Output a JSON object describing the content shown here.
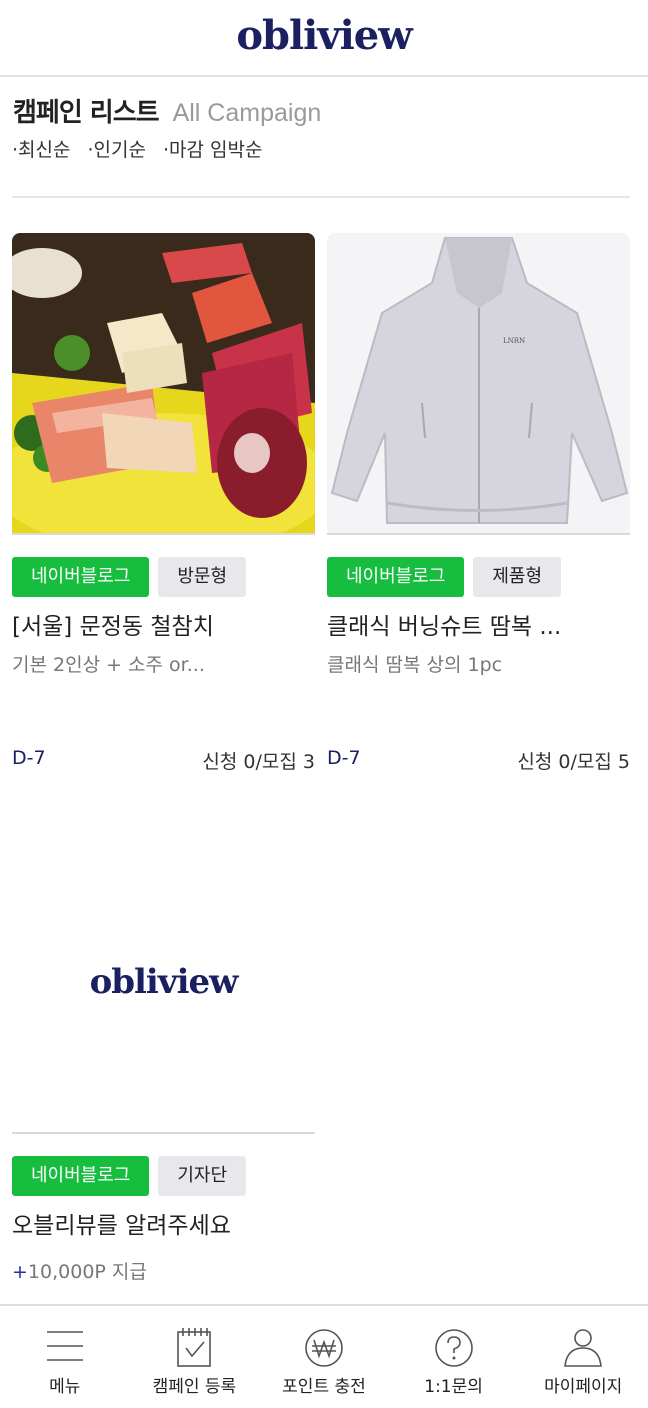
{
  "header": {
    "logo": "obliview"
  },
  "section": {
    "title": "캠페인 리스트",
    "subtitle": "All Campaign",
    "sort_options": [
      "·최신순",
      "·인기순",
      "·마감 임박순"
    ]
  },
  "campaigns": [
    {
      "image": "sashimi-photo",
      "tags": [
        "네이버블로그",
        "방문형"
      ],
      "title": "[서울] 문정동 철참치",
      "desc": "기본 2인상 + 소주 or...",
      "dday": "D-7",
      "apply": "신청 0/모집 3"
    },
    {
      "image": "jacket-photo",
      "tags": [
        "네이버블로그",
        "제품형"
      ],
      "title": "클래식 버닝슈트 땀복 ...",
      "desc": "클래식 땀복 상의 1pc",
      "dday": "D-7",
      "apply": "신청 0/모집 5",
      "product_mark": "LNRN"
    },
    {
      "image": "obliview-logo",
      "logo_text": "obliview",
      "tags": [
        "네이버블로그",
        "기자단"
      ],
      "title": "오블리뷰를 알려주세요",
      "point_plus": "+",
      "point": "10,000P 지급"
    }
  ],
  "bottom_nav": [
    {
      "label": "메뉴",
      "icon": "hamburger-menu-icon"
    },
    {
      "label": "캠페인 등록",
      "icon": "calendar-check-icon"
    },
    {
      "label": "포인트 충전",
      "icon": "won-coin-icon"
    },
    {
      "label": "1:1문의",
      "icon": "question-circle-icon"
    },
    {
      "label": "마이페이지",
      "icon": "user-icon"
    }
  ],
  "colors": {
    "brand": "#1b2160",
    "naver_green": "#17bd3f",
    "tag_gray": "#e8e8ec"
  }
}
